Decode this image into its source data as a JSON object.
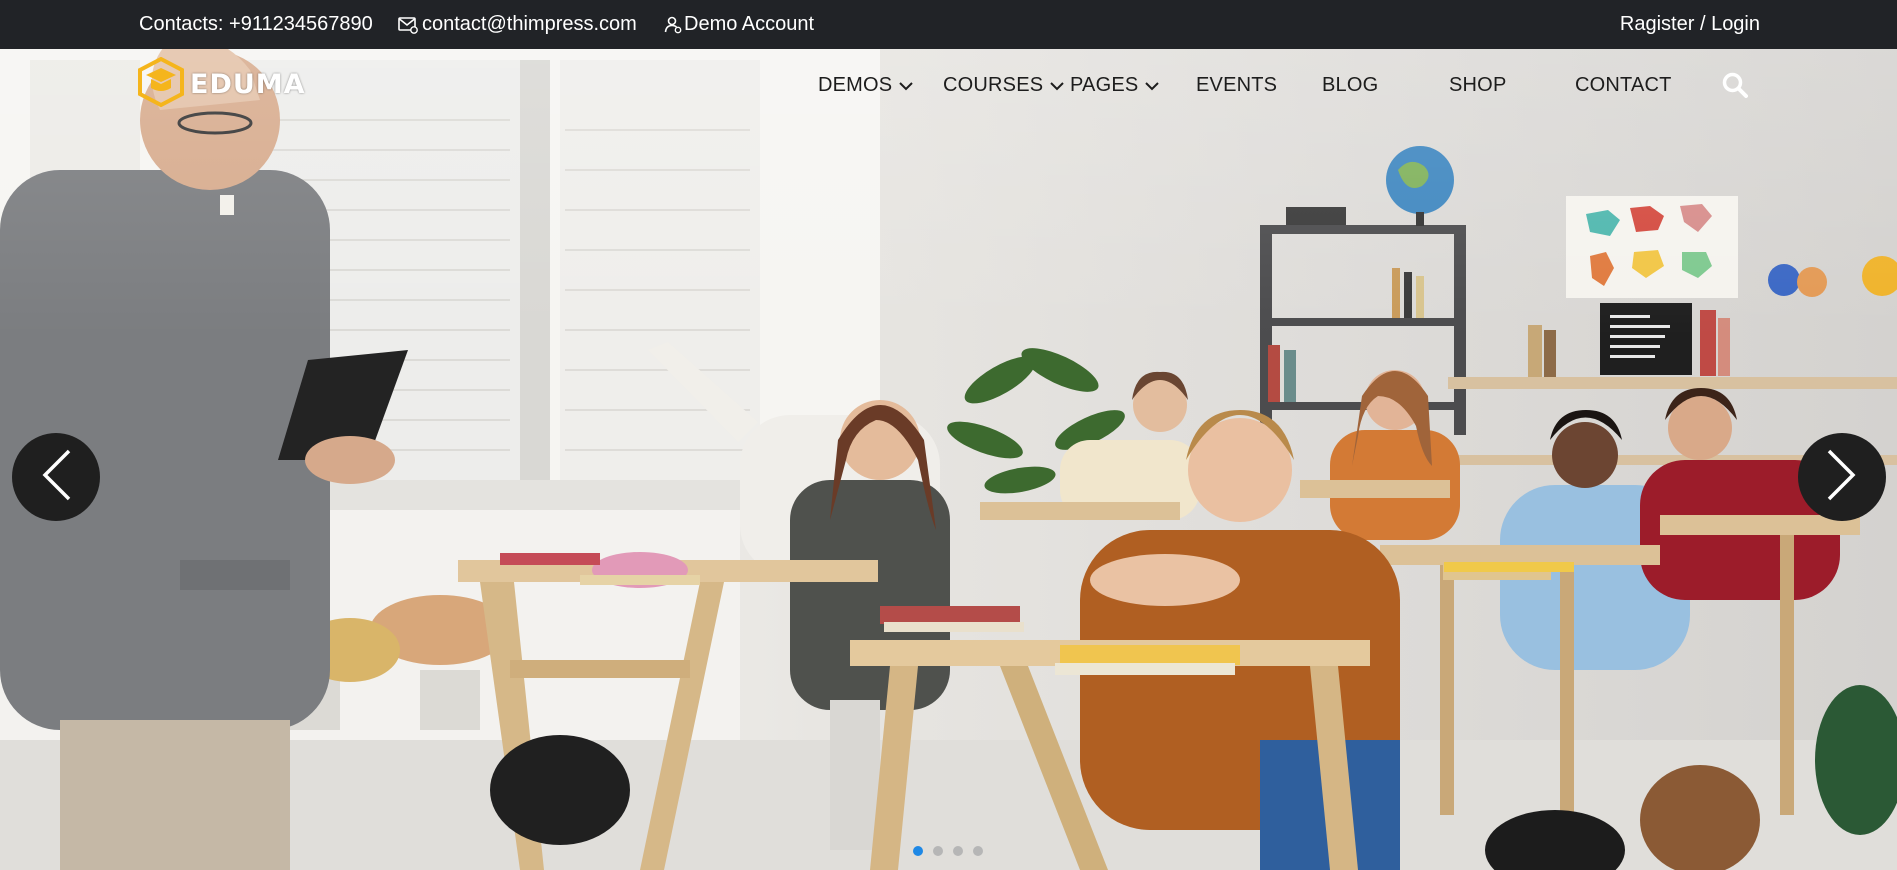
{
  "topbar": {
    "contacts": "Contacts: +911234567890",
    "email": "contact@thimpress.com",
    "demo_account": "Demo Account",
    "register_login": "Ragister / Login"
  },
  "brand": {
    "name": "EDUMA",
    "accent": "#f5b51c"
  },
  "nav": {
    "items": [
      {
        "label": "DEMOS",
        "dropdown": true
      },
      {
        "label": "COURSES",
        "dropdown": true
      },
      {
        "label": "PAGES",
        "dropdown": true
      },
      {
        "label": "EVENTS",
        "dropdown": false
      },
      {
        "label": "BLOG",
        "dropdown": false
      },
      {
        "label": "SHOP",
        "dropdown": false
      },
      {
        "label": "CONTACT",
        "dropdown": false
      }
    ],
    "search_icon": "search-icon"
  },
  "slider": {
    "slides": 4,
    "active_slide": 1,
    "prev_icon": "chevron-left-icon",
    "next_icon": "chevron-right-icon",
    "active_color": "#1e88e5"
  },
  "colors": {
    "topbar_bg": "#212327",
    "text_dark": "#1d1d1d",
    "arrow_bg": "#1f1f1f"
  }
}
